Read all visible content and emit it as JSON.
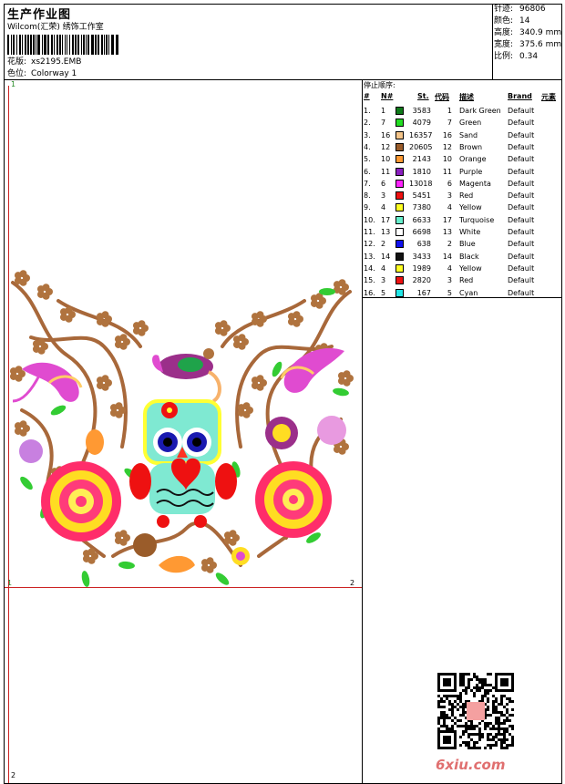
{
  "header": {
    "title": "生产作业图",
    "subtitle": "Wilcom(汇荣) 绣饰工作室",
    "design_label": "花版:",
    "design_value": "xs2195.EMB",
    "colorway_label": "色位:",
    "colorway_value": "Colorway 1"
  },
  "stats": [
    {
      "label": "针迹:",
      "value": "96806"
    },
    {
      "label": "颜色:",
      "value": "14"
    },
    {
      "label": "高度:",
      "value": "340.9 mm"
    },
    {
      "label": "宽度:",
      "value": "375.6 mm"
    },
    {
      "label": "比例:",
      "value": "0.34"
    }
  ],
  "table": {
    "title": "停止顺序:",
    "headers": {
      "num": "#",
      "n": "N#",
      "st": "St.",
      "code": "代码",
      "desc": "描述",
      "brand": "Brand",
      "element": "元素"
    },
    "rows": [
      {
        "num": "1.",
        "n": "1",
        "color": "#0f7a1a",
        "st": "3583",
        "code": "1",
        "desc": "Dark Green",
        "brand": "Default"
      },
      {
        "num": "2.",
        "n": "7",
        "color": "#22dd22",
        "st": "4079",
        "code": "7",
        "desc": "Green",
        "brand": "Default"
      },
      {
        "num": "3.",
        "n": "16",
        "color": "#f5c58a",
        "st": "16357",
        "code": "16",
        "desc": "Sand",
        "brand": "Default"
      },
      {
        "num": "4.",
        "n": "12",
        "color": "#9a5c2a",
        "st": "20605",
        "code": "12",
        "desc": "Brown",
        "brand": "Default"
      },
      {
        "num": "5.",
        "n": "10",
        "color": "#ff9933",
        "st": "2143",
        "code": "10",
        "desc": "Orange",
        "brand": "Default"
      },
      {
        "num": "6.",
        "n": "11",
        "color": "#8a1fbf",
        "st": "1810",
        "code": "11",
        "desc": "Purple",
        "brand": "Default"
      },
      {
        "num": "7.",
        "n": "6",
        "color": "#ff22ff",
        "st": "13018",
        "code": "6",
        "desc": "Magenta",
        "brand": "Default"
      },
      {
        "num": "8.",
        "n": "3",
        "color": "#ee1111",
        "st": "5451",
        "code": "3",
        "desc": "Red",
        "brand": "Default"
      },
      {
        "num": "9.",
        "n": "4",
        "color": "#ffff22",
        "st": "7380",
        "code": "4",
        "desc": "Yellow",
        "brand": "Default"
      },
      {
        "num": "10.",
        "n": "17",
        "color": "#66eecc",
        "st": "6633",
        "code": "17",
        "desc": "Turquoise",
        "brand": "Default"
      },
      {
        "num": "11.",
        "n": "13",
        "color": "#ffffff",
        "st": "6698",
        "code": "13",
        "desc": "White",
        "brand": "Default"
      },
      {
        "num": "12.",
        "n": "2",
        "color": "#1111ee",
        "st": "638",
        "code": "2",
        "desc": "Blue",
        "brand": "Default"
      },
      {
        "num": "13.",
        "n": "14",
        "color": "#111111",
        "st": "3433",
        "code": "14",
        "desc": "Black",
        "brand": "Default"
      },
      {
        "num": "14.",
        "n": "4",
        "color": "#ffff22",
        "st": "1989",
        "code": "4",
        "desc": "Yellow",
        "brand": "Default"
      },
      {
        "num": "15.",
        "n": "3",
        "color": "#ee1111",
        "st": "2820",
        "code": "3",
        "desc": "Red",
        "brand": "Default"
      },
      {
        "num": "16.",
        "n": "5",
        "color": "#22e6e6",
        "st": "167",
        "code": "5",
        "desc": "Cyan",
        "brand": "Default"
      }
    ]
  },
  "marks": {
    "tl": "1",
    "bl_upper": "1",
    "br_upper": "2",
    "bottom": "2"
  },
  "watermark": "6xiu.com"
}
